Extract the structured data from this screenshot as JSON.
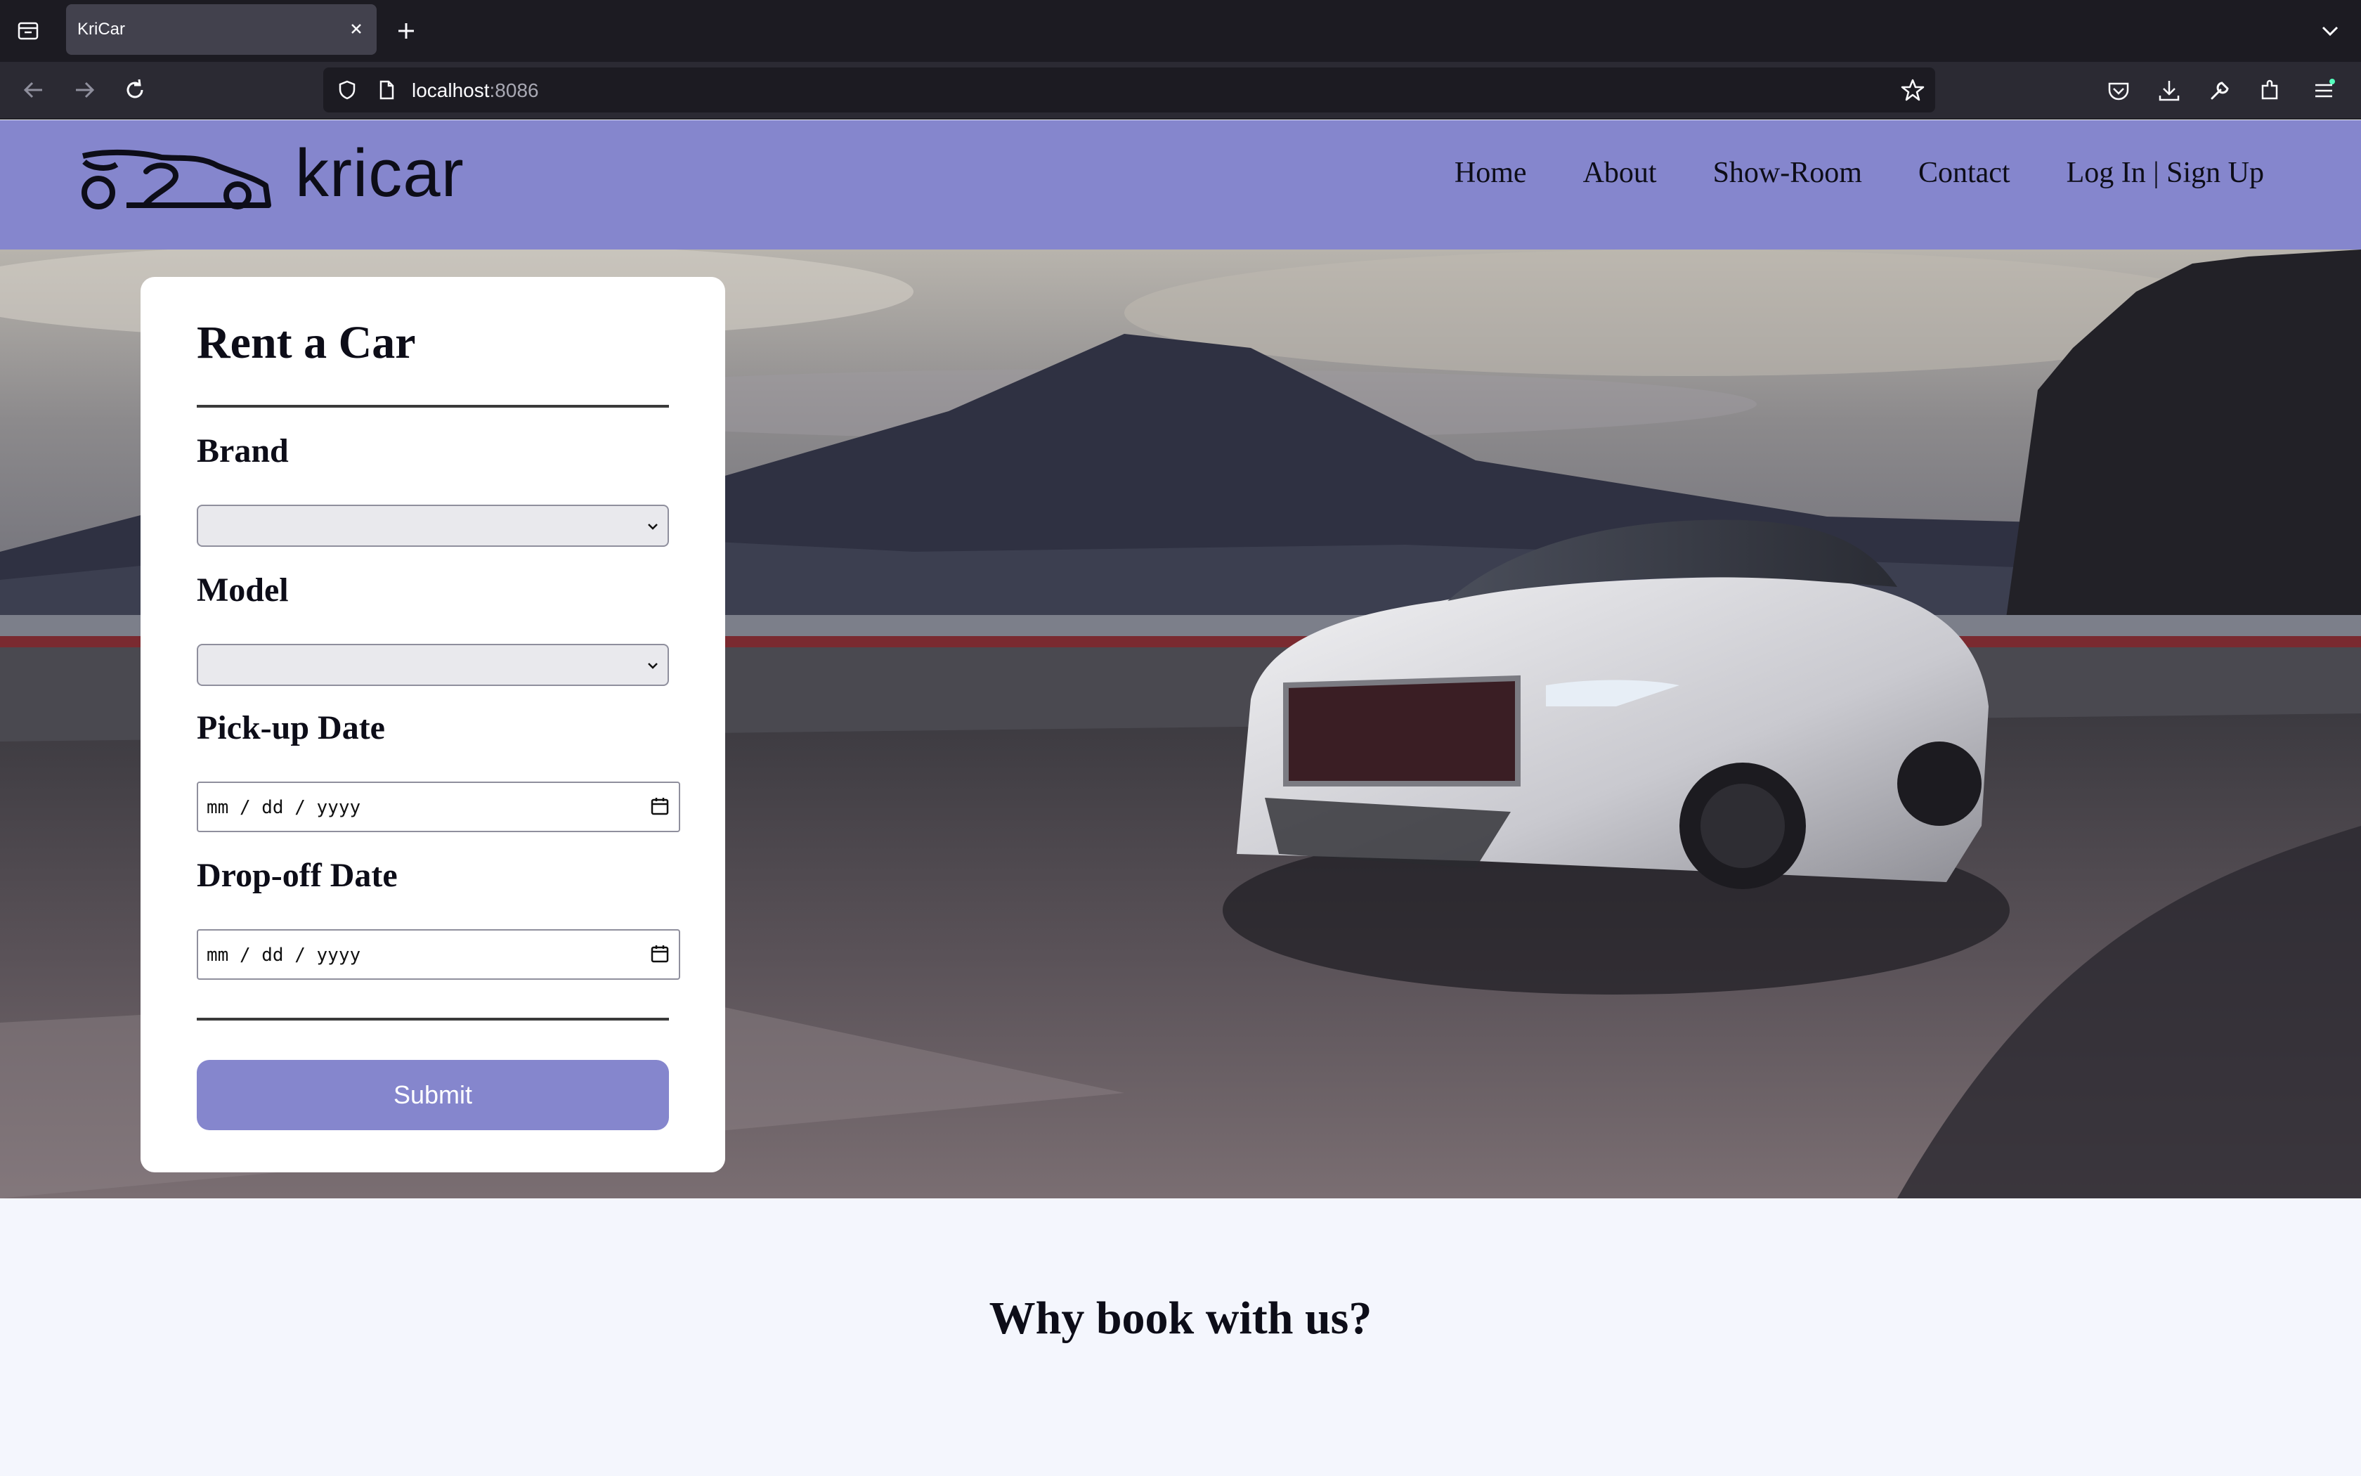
{
  "browser": {
    "tab_title": "KriCar",
    "url_host": "localhost",
    "url_port": ":8086",
    "icons": [
      "tab-overview-icon",
      "close-icon",
      "plus-icon",
      "chevron-down-icon",
      "back-arrow-icon",
      "forward-arrow-icon",
      "reload-icon",
      "shield-icon",
      "page-icon",
      "star-icon",
      "pocket-icon",
      "download-icon",
      "wrench-icon",
      "extensions-icon",
      "menu-icon"
    ]
  },
  "site": {
    "logo_text": "kricar",
    "nav": {
      "home": "Home",
      "about": "About",
      "showroom": "Show-Room",
      "contact": "Contact",
      "auth": "Log In | Sign Up"
    },
    "accent_color": "#8586cd"
  },
  "form": {
    "title": "Rent a Car",
    "brand_label": "Brand",
    "brand_value": "",
    "model_label": "Model",
    "model_value": "",
    "pickup_label": "Pick-up Date",
    "pickup_placeholder": "mm / dd / yyyy",
    "dropoff_label": "Drop-off Date",
    "dropoff_placeholder": "mm / dd / yyyy",
    "submit_label": "Submit"
  },
  "section": {
    "why_title": "Why book with us?"
  }
}
